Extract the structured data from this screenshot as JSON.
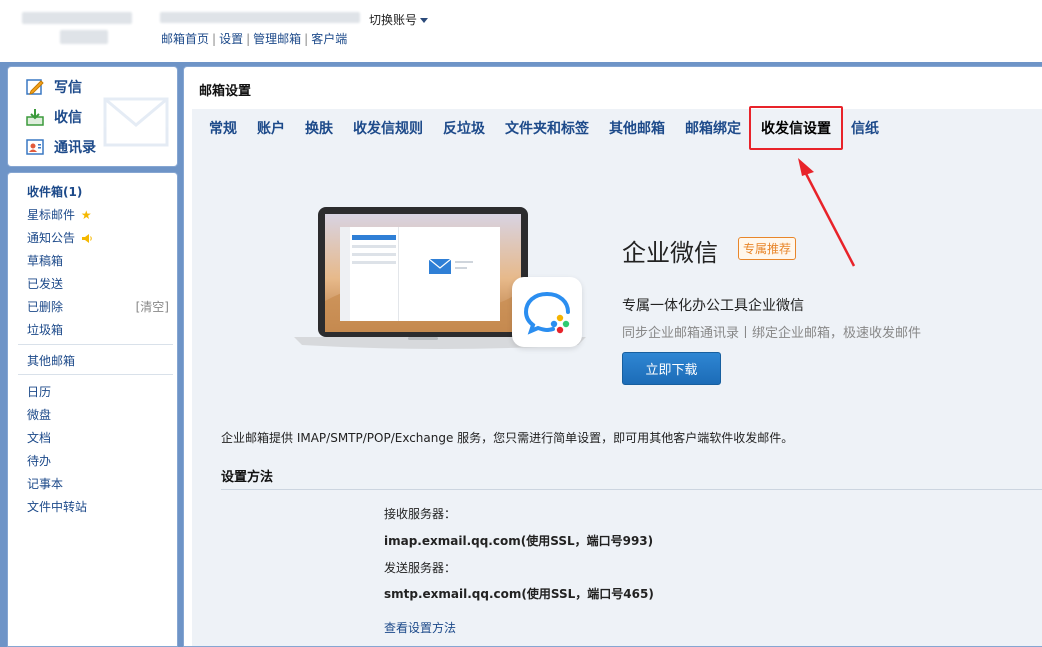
{
  "header": {
    "switch_account_label": "切换账号",
    "top_links": [
      {
        "label": "邮箱首页"
      },
      {
        "label": "设置"
      },
      {
        "label": "管理邮箱"
      },
      {
        "label": "客户端"
      }
    ]
  },
  "sidebar": {
    "actions": [
      {
        "label": "写信",
        "icon": "write-icon"
      },
      {
        "label": "收信",
        "icon": "receive-icon"
      },
      {
        "label": "通讯录",
        "icon": "contacts-icon"
      }
    ],
    "folders_primary": [
      {
        "label": "收件箱(1)"
      },
      {
        "label": "星标邮件",
        "icon": "star-icon"
      },
      {
        "label": "通知公告",
        "icon": "speaker-icon"
      },
      {
        "label": "草稿箱"
      },
      {
        "label": "已发送"
      },
      {
        "label": "已删除",
        "action": "[清空]"
      },
      {
        "label": "垃圾箱"
      }
    ],
    "other_mailboxes_label": "其他邮箱",
    "apps": [
      {
        "label": "日历"
      },
      {
        "label": "微盘"
      },
      {
        "label": "文档"
      },
      {
        "label": "待办"
      },
      {
        "label": "记事本"
      },
      {
        "label": "文件中转站"
      }
    ]
  },
  "main": {
    "title": "邮箱设置",
    "tabs": [
      {
        "label": "常规"
      },
      {
        "label": "账户"
      },
      {
        "label": "换肤"
      },
      {
        "label": "收发信规则"
      },
      {
        "label": "反垃圾"
      },
      {
        "label": "文件夹和标签"
      },
      {
        "label": "其他邮箱"
      },
      {
        "label": "邮箱绑定"
      },
      {
        "label": "收发信设置"
      },
      {
        "label": "信纸"
      }
    ],
    "active_tab": "收发信设置",
    "promo": {
      "title": "企业微信",
      "badge": "专属推荐",
      "subtitle": "专属一体化办公工具企业微信",
      "description": "同步企业邮箱通讯录丨绑定企业邮箱，极速收发邮件",
      "button": "立即下载"
    },
    "intro_text": "企业邮箱提供 IMAP/SMTP/POP/Exchange 服务，您只需进行简单设置，即可用其他客户端软件收发邮件。",
    "method_heading": "设置方法",
    "servers": {
      "receive_label": "接收服务器：",
      "receive_value": "imap.exmail.qq.com(使用SSL，端口号993)",
      "send_label": "发送服务器：",
      "send_value": "smtp.exmail.qq.com(使用SSL，端口号465)"
    },
    "view_method_link": "查看设置方法"
  },
  "colors": {
    "frame_blue": "#6e94c7",
    "link_blue": "#1d4a8a",
    "highlight_red": "#e8232a",
    "badge_orange": "#e8862a",
    "button_blue": "#1c6cb7",
    "settings_bg": "#eef2f7"
  }
}
